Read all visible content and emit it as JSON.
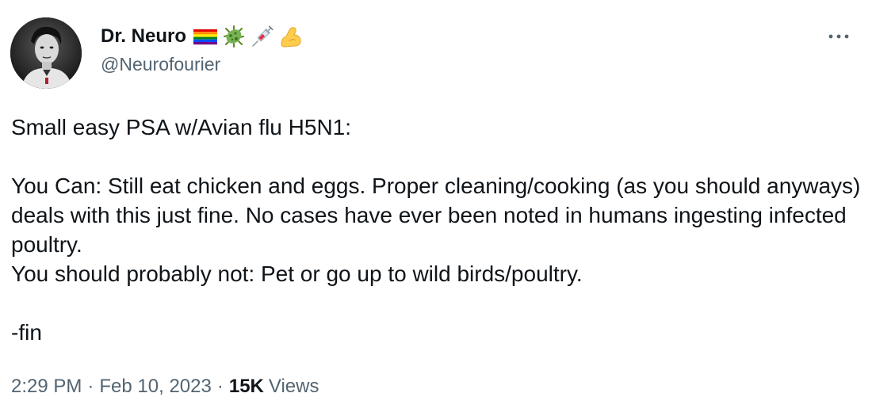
{
  "author": {
    "display_name": "Dr. Neuro",
    "handle": "@Neurofourier",
    "name_emojis": [
      "rainbow-flag-icon",
      "microbe-icon",
      "syringe-icon",
      "flexed-biceps-icon"
    ]
  },
  "tweet": {
    "text": "Small easy PSA w/Avian flu H5N1:\n\nYou Can: Still eat chicken and eggs. Proper cleaning/cooking (as you should anyways) deals with this just fine. No cases have ever been noted in humans ingesting infected poultry.\nYou should probably not: Pet or go up to wild birds/poultry.\n\n-fin",
    "time": "2:29 PM",
    "date": "Feb 10, 2023",
    "separator": "·",
    "views_count": "15K",
    "views_label": "Views"
  },
  "colors": {
    "text_primary": "#0f1419",
    "text_secondary": "#536471",
    "background": "#ffffff"
  }
}
